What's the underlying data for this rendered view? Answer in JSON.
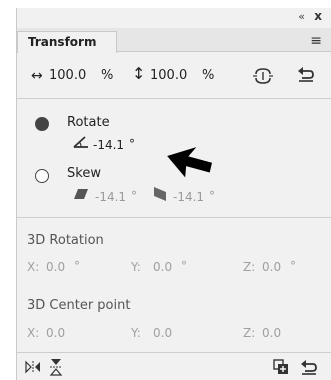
{
  "window": {
    "collapse_icon": "double-chevron-left-icon",
    "close_label": "x"
  },
  "tabs": [
    {
      "label": "Transform"
    }
  ],
  "scale": {
    "width_value": "100.0",
    "width_unit": "%",
    "height_value": "100.0",
    "height_unit": "%"
  },
  "rotate": {
    "label": "Rotate",
    "value": "-14.1",
    "unit": "°"
  },
  "skew": {
    "label": "Skew",
    "h_value": "-14.1",
    "h_unit": "°",
    "v_value": "-14.1",
    "v_unit": "°"
  },
  "rotation3d": {
    "title": "3D Rotation",
    "x_label": "X:",
    "x_value": "0.0",
    "x_unit": "°",
    "y_label": "Y:",
    "y_value": "0.0",
    "y_unit": "°",
    "z_label": "Z:",
    "z_value": "0.0",
    "z_unit": "°"
  },
  "center3d": {
    "title": "3D Center point",
    "x_label": "X:",
    "x_value": "0.0",
    "y_label": "Y:",
    "y_value": "0.0",
    "z_label": "Z:",
    "z_value": "0.0"
  },
  "colors": {
    "panel_bg": "#f1f1f1",
    "dim_text": "#9a9a9a"
  }
}
